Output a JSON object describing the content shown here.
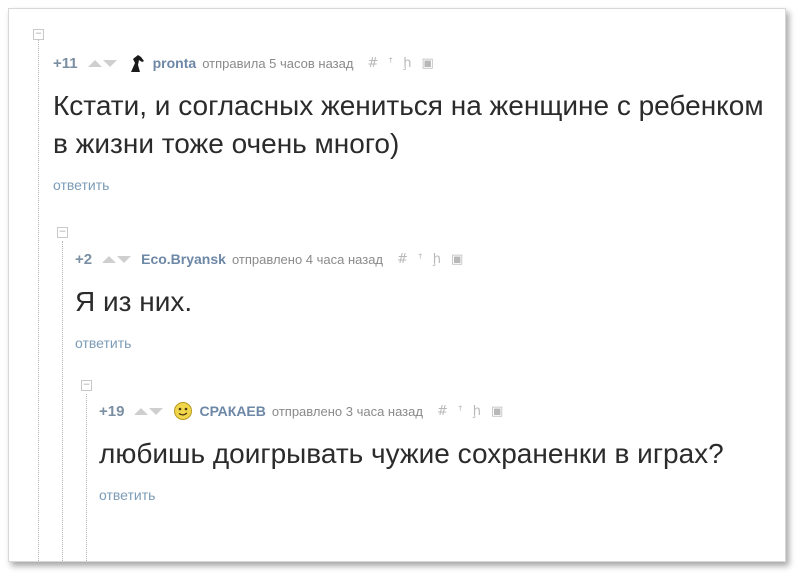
{
  "comments": [
    {
      "rating": "+11",
      "username": "pronta",
      "meta": "отправила 5 часов назад",
      "text": "Кстати, и согласных жениться на женщине с ребенком в жизни тоже очень много)",
      "reply": "ответить",
      "avatar": "horse-head-icon"
    },
    {
      "rating": "+2",
      "username": "Eco.Bryansk",
      "meta": "отправлено 4 часа назад",
      "text": "Я из них.",
      "reply": "ответить",
      "avatar": "none"
    },
    {
      "rating": "+19",
      "username": "СРАКАЕВ",
      "meta": "отправлено 3 часа назад",
      "text": "любишь доигрывать чужие сохраненки в играх?",
      "reply": "ответить",
      "avatar": "smiley-face-icon"
    }
  ],
  "icons": {
    "collapse": "minus-box-icon",
    "permalink": "hash-icon",
    "parent": "arrow-up-icon",
    "branch": "branch-icon",
    "save": "floppy-disk-icon"
  },
  "tool_glyphs": {
    "permalink": "#",
    "parent": "ꜛ",
    "branch": "ḩ",
    "save": "▣"
  },
  "colors": {
    "rating": "#7b8fa3",
    "username": "#6d87a6",
    "reply_link": "#7b9bb7",
    "text": "#2b2b2b",
    "meta": "#8a8a8a"
  }
}
